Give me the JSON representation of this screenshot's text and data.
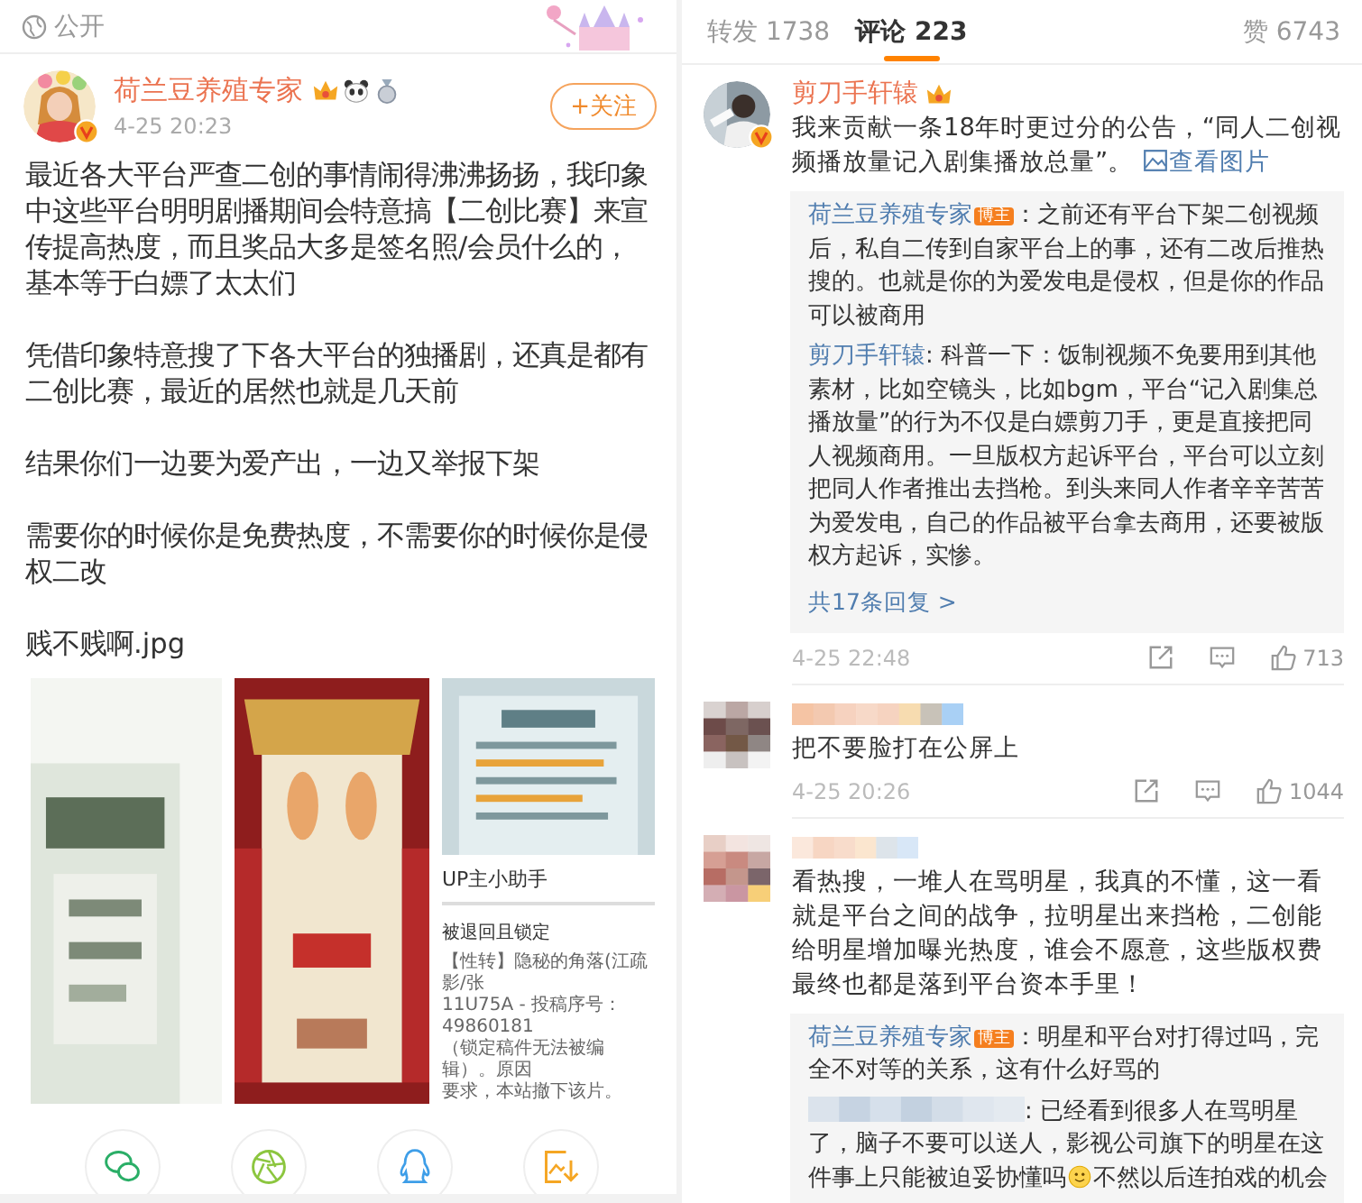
{
  "left": {
    "visibility": "公开",
    "author": {
      "name": "荷兰豆养殖专家",
      "verified": true,
      "badges": [
        {
          "kind": "crown"
        },
        {
          "kind": "panda"
        },
        {
          "kind": "medal"
        }
      ],
      "time": "4-25 20:23"
    },
    "follow_button": "+关注",
    "paragraphs": [
      "最近各大平台严查二创的事情闹得沸沸扬扬，我印象中这些平台明明剧播期间会特意搞【二创比赛】来宣传提高热度，而且奖品大多是签名照/会员什么的，基本等于白嫖了太太们",
      "凭借印象特意搜了下各大平台的独播剧，还真是都有二创比赛，最近的居然也就是几天前",
      "结果你们一边要为爱产出，一边又举报下架",
      "需要你的时候你是免费热度，不需要你的时候你是侵权二改",
      "贱不贱啊.jpg"
    ],
    "images": [
      {
        "kind": "picture"
      },
      {
        "kind": "picture"
      },
      {
        "kind": "screenshot",
        "title": "UP主小助手",
        "heading": "被退回且锁定",
        "lines": [
          "【性转】隐秘的角落(江疏影/张",
          "11U75A - 投稿序号：49860181",
          "（锁定稿件无法被编辑）。原因",
          "要求，本站撤下该片。"
        ]
      }
    ],
    "share_targets": [
      {
        "kind": "wechat"
      },
      {
        "kind": "moments"
      },
      {
        "kind": "qq"
      },
      {
        "kind": "save"
      }
    ]
  },
  "right": {
    "tabs": [
      {
        "label": "转发",
        "count": "1738",
        "selected": false
      },
      {
        "label": "评论",
        "count": "223",
        "selected": true
      },
      {
        "label": "赞",
        "count": "6743",
        "selected": false
      }
    ],
    "comments": [
      {
        "redacted": false,
        "author": "剪刀手轩辕",
        "verified": true,
        "badges": [
          {
            "kind": "crown"
          }
        ],
        "text": "我来贡献一条18年时更过分的公告，“同人二创视频播放量记入剧集播放总量”。",
        "link": "查看图片",
        "replies": [
          {
            "redacted": false,
            "author": "荷兰豆养殖专家",
            "badge": "博主",
            "text": "：之前还有平台下架二创视频后，私自二传到自家平台上的事，还有二改后推热搜的。也就是你的为爱发电是侵权，但是你的作品可以被商用"
          },
          {
            "redacted": false,
            "author": "剪刀手轩辕",
            "text": ": 科普一下：饭制视频不免要用到其他素材，比如空镜头，比如bgm，平台“记入剧集总播放量”的行为不仅是白嫖剪刀手，更是直接把同人视频商用。一旦版权方起诉平台，平台可以立刻把同人作者推出去挡枪。到头来同人作者辛辛苦苦为爱发电，自己的作品被平台拿去商用，还要被版权方起诉，实惨。"
          }
        ],
        "more_replies": "共17条回复 >",
        "time": "4-25 22:48",
        "likes": "713"
      },
      {
        "redacted": true,
        "text": "把不要脸打在公屏上",
        "time": "4-25 20:26",
        "likes": "1044"
      },
      {
        "redacted": true,
        "text": "看热搜，一堆人在骂明星，我真的不懂，这一看就是平台之间的战争，拉明星出来挡枪，二创能给明星增加曝光热度，谁会不愿意，这些版权费最终也都是落到平台资本手里！",
        "replies": [
          {
            "redacted": false,
            "author": "荷兰豆养殖专家",
            "badge": "博主",
            "text": "：明星和平台对打得过吗，完全不对等的关系，这有什么好骂的"
          },
          {
            "redacted": true,
            "text": ": 已经看到很多人在骂明星了，脑子不要可以送人，影视公司旗下的明星在这件事上只能被迫妥协懂吗",
            "emoji": {
              "kind": "smile"
            },
            "text_after": "不然以后连拍戏的机会"
          }
        ]
      }
    ]
  }
}
